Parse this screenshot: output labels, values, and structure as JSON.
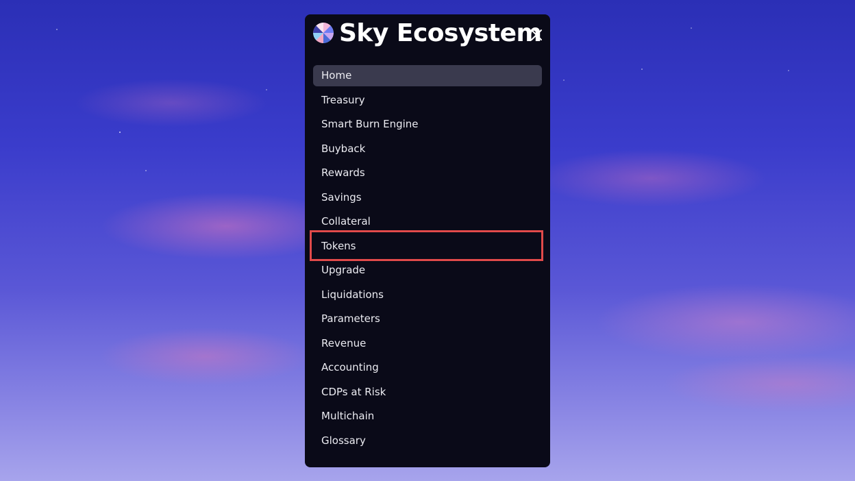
{
  "menu": {
    "title": "Sky Ecosystem",
    "logo_icon": "sky-pinwheel-logo",
    "close_icon": "close-x",
    "active_item": "Home",
    "highlighted_item": "Tokens",
    "highlight_color": "#e14a4a",
    "items": [
      {
        "label": "Home"
      },
      {
        "label": "Treasury"
      },
      {
        "label": "Smart Burn Engine"
      },
      {
        "label": "Buyback"
      },
      {
        "label": "Rewards"
      },
      {
        "label": "Savings"
      },
      {
        "label": "Collateral"
      },
      {
        "label": "Tokens"
      },
      {
        "label": "Upgrade"
      },
      {
        "label": "Liquidations"
      },
      {
        "label": "Parameters"
      },
      {
        "label": "Revenue"
      },
      {
        "label": "Accounting"
      },
      {
        "label": "CDPs at Risk"
      },
      {
        "label": "Multichain"
      },
      {
        "label": "Glossary"
      }
    ]
  }
}
